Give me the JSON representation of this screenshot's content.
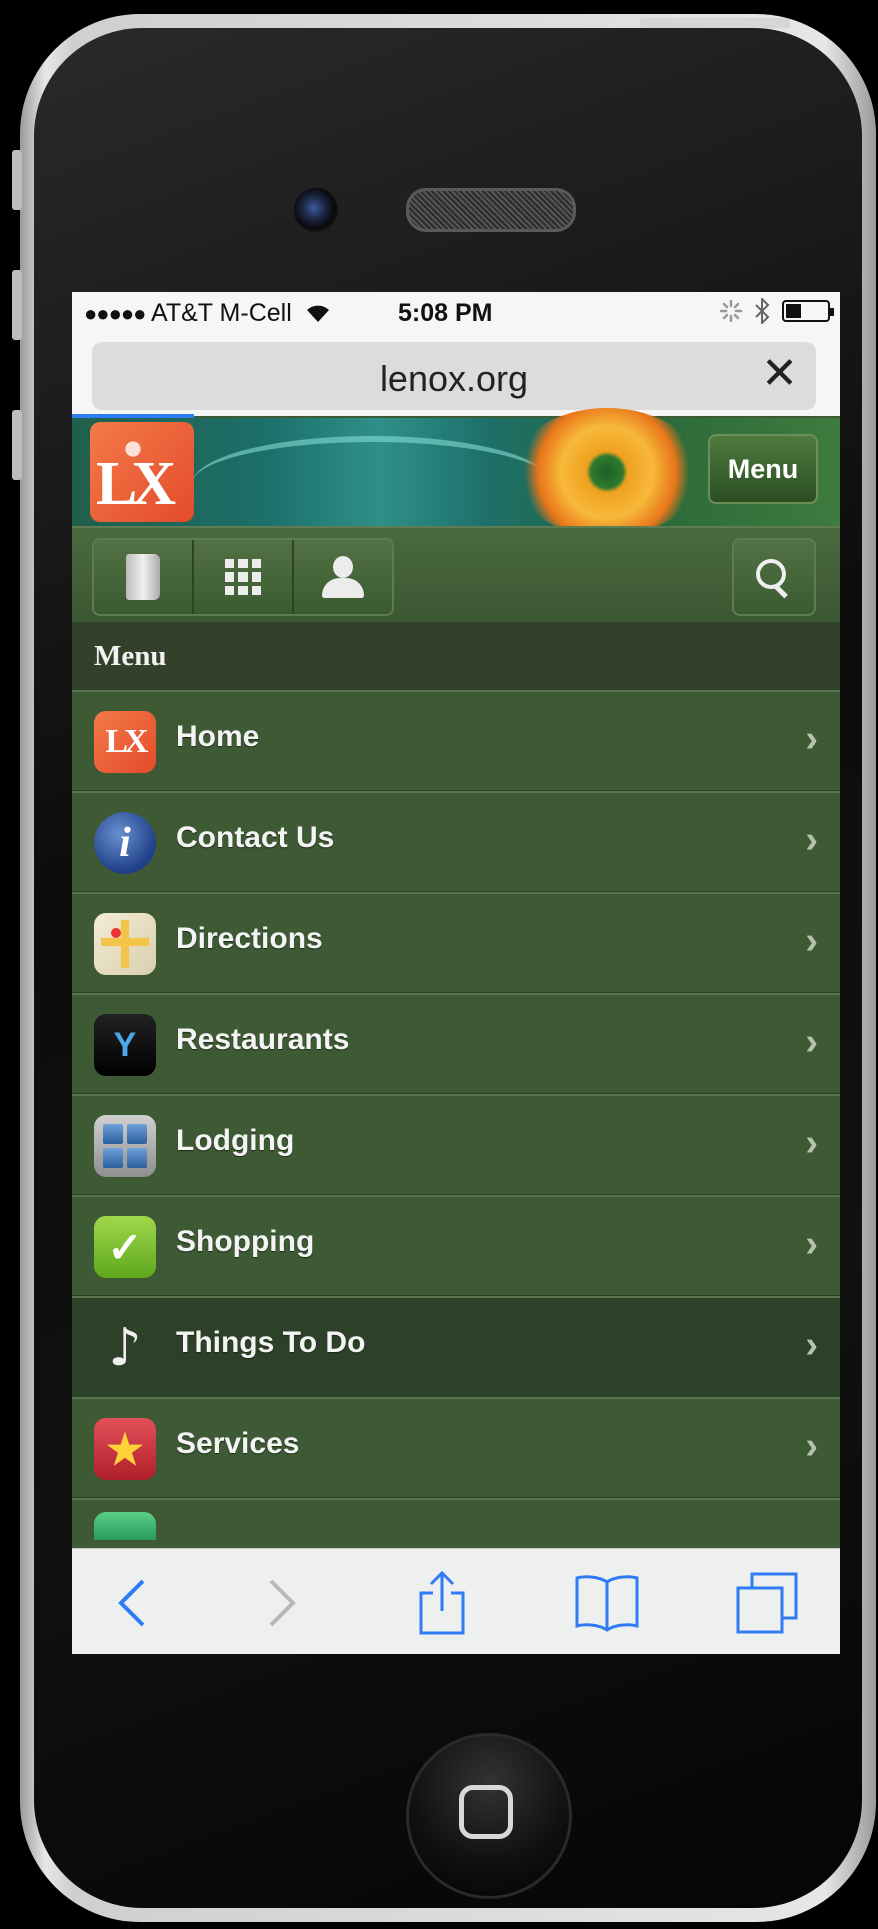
{
  "status_bar": {
    "signal": "●●●●●",
    "carrier": "AT&T M-Cell",
    "wifi": "wifi-icon",
    "time": "5:08 PM",
    "activity": "activity-spinner-icon",
    "bluetooth": "bluetooth-icon",
    "battery": "battery-icon"
  },
  "browser": {
    "url": "lenox.org",
    "close_glyph": "✕"
  },
  "site": {
    "logo_text": "LX",
    "menu_button": "Menu",
    "toolbar": [
      "book-icon",
      "grid-icon",
      "person-icon",
      "search-icon"
    ]
  },
  "menu": {
    "heading": "Menu",
    "items": [
      {
        "label": "Home",
        "icon": "lx-logo-icon",
        "glyph": "LX"
      },
      {
        "label": "Contact Us",
        "icon": "info-icon",
        "glyph": "i"
      },
      {
        "label": "Directions",
        "icon": "map-icon",
        "glyph": ""
      },
      {
        "label": "Restaurants",
        "icon": "cocktail-icon",
        "glyph": "Y"
      },
      {
        "label": "Lodging",
        "icon": "building-icon",
        "glyph": ""
      },
      {
        "label": "Shopping",
        "icon": "checkmark-icon",
        "glyph": "✓"
      },
      {
        "label": "Things To Do",
        "icon": "music-note-icon",
        "glyph": "♪",
        "active": true
      },
      {
        "label": "Services",
        "icon": "star-icon",
        "glyph": "★"
      }
    ],
    "chevron": "›"
  },
  "bottom_bar": [
    "back-icon",
    "forward-icon",
    "share-icon",
    "bookmarks-icon",
    "tabs-icon"
  ],
  "colors": {
    "accent": "#2f7cf6",
    "menu_bg": "#3e5a35",
    "menu_active": "#2d4028",
    "heading_bg": "#33412a"
  }
}
